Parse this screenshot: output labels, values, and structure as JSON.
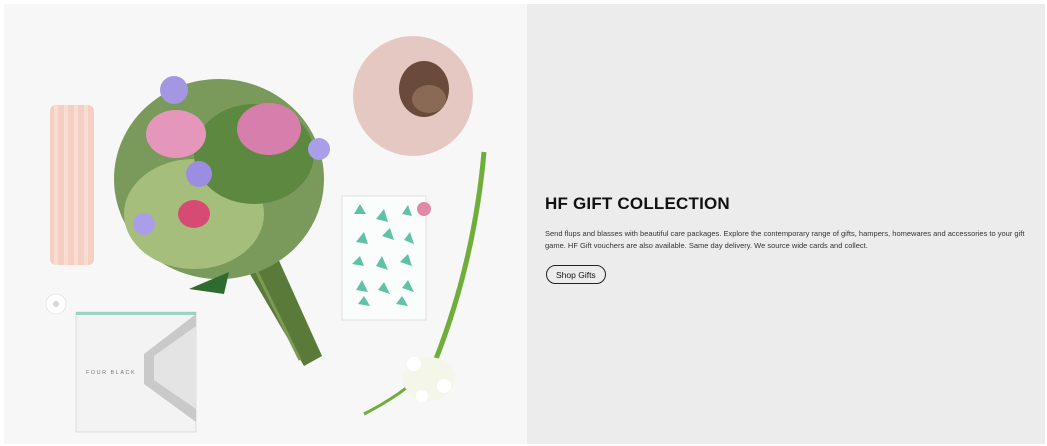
{
  "promo": {
    "title": "HF GIFT COLLECTION",
    "description": "Send flups and blasses with beautiful care packages. Explore the contemporary range of gifts, hampers, homewares and accessories to your gift game. HF Gift vouchers are also available. Same day delivery. We source wide cards and collect.",
    "cta_label": "Shop Gifts"
  },
  "image": {
    "box_text": "FOUR BLACK"
  },
  "colors": {
    "panel_bg": "#ececec",
    "photo_bg": "#f7f7f7",
    "candle": "#f5cfc2",
    "vase": "#e6c8c3",
    "card_accent": "#5fc1a6"
  }
}
